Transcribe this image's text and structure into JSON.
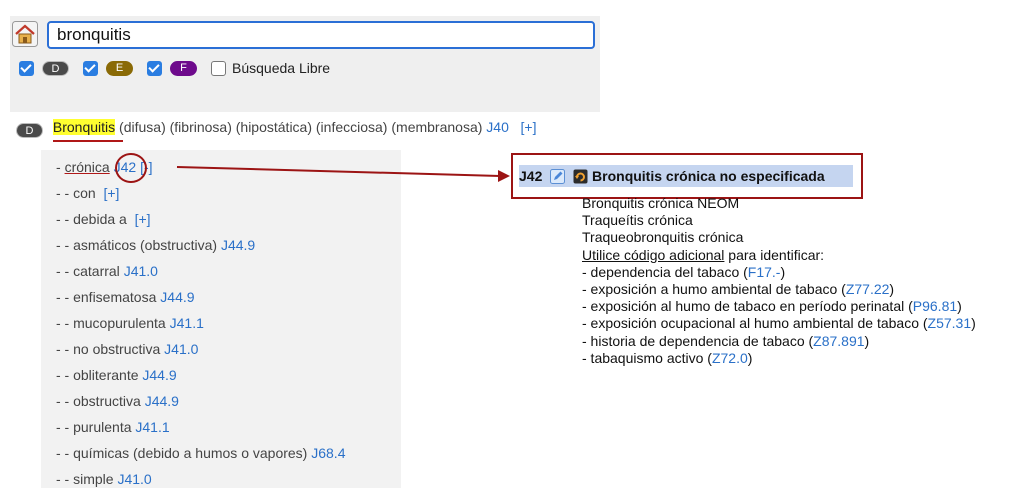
{
  "search": {
    "value": "bronquitis"
  },
  "filters": [
    {
      "badge": "D",
      "checked": true
    },
    {
      "badge": "E",
      "checked": true
    },
    {
      "badge": "F",
      "checked": true
    }
  ],
  "free_search": {
    "label": "Búsqueda Libre",
    "checked": false
  },
  "entry": {
    "badge": "D",
    "term": "Bronquitis",
    "modifiers": "(difusa) (fibrinosa) (hipostática) (infecciosa) (membranosa)",
    "code": "J40",
    "toggle": "[+]"
  },
  "subentries": [
    {
      "prefix": "- ",
      "text": "crónica",
      "code": "J42",
      "toggle": "[-]"
    },
    {
      "prefix": "- - ",
      "text": "con",
      "code": "",
      "toggle": "[+]"
    },
    {
      "prefix": "- - ",
      "text": "debida a",
      "code": "",
      "toggle": "[+]"
    },
    {
      "prefix": "- - ",
      "text": "asmáticos (obstructiva)",
      "code": "J44.9",
      "toggle": ""
    },
    {
      "prefix": "- - ",
      "text": "catarral",
      "code": "J41.0",
      "toggle": ""
    },
    {
      "prefix": "- - ",
      "text": "enfisematosa",
      "code": "J44.9",
      "toggle": ""
    },
    {
      "prefix": "- - ",
      "text": "mucopurulenta",
      "code": "J41.1",
      "toggle": ""
    },
    {
      "prefix": "- - ",
      "text": "no obstructiva",
      "code": "J41.0",
      "toggle": ""
    },
    {
      "prefix": "- - ",
      "text": "obliterante",
      "code": "J44.9",
      "toggle": ""
    },
    {
      "prefix": "- - ",
      "text": "obstructiva",
      "code": "J44.9",
      "toggle": ""
    },
    {
      "prefix": "- - ",
      "text": "purulenta",
      "code": "J41.1",
      "toggle": ""
    },
    {
      "prefix": "- - ",
      "text": "químicas (debido a humos o vapores)",
      "code": "J68.4",
      "toggle": ""
    },
    {
      "prefix": "- - ",
      "text": "simple",
      "code": "J41.0",
      "toggle": ""
    }
  ],
  "detail": {
    "code": "J42",
    "title": "Bronquitis crónica no especificada",
    "inclusions": [
      "Bronquitis crónica NEOM",
      "Traqueítis crónica",
      "Traqueobronquitis crónica"
    ],
    "use_additional": "Utilice código adicional",
    "use_additional_suffix": " para identificar:",
    "items": [
      {
        "text": "- dependencia del tabaco (",
        "code": "F17.-",
        "close": ")"
      },
      {
        "text": "- exposición a humo ambiental de tabaco (",
        "code": "Z77.22",
        "close": ")"
      },
      {
        "text": "- exposición al humo de tabaco en período perinatal (",
        "code": "P96.81",
        "close": ")"
      },
      {
        "text": "- exposición ocupacional al humo ambiental de tabaco (",
        "code": "Z57.31",
        "close": ")"
      },
      {
        "text": "- historia de dependencia de tabaco (",
        "code": "Z87.891",
        "close": ")"
      },
      {
        "text": "- tabaquismo activo (",
        "code": "Z72.0",
        "close": ")"
      }
    ]
  }
}
